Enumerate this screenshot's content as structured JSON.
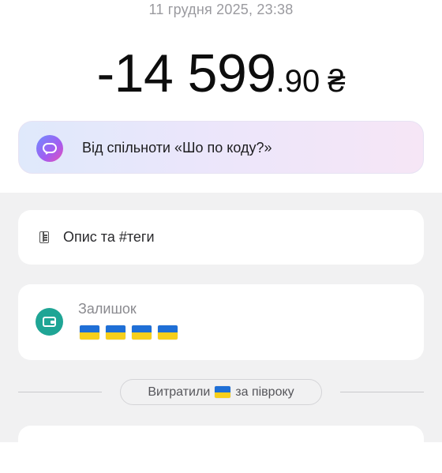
{
  "transaction": {
    "timestamp": "11 грудня 2025, 23:38",
    "amount_main": "-14 599",
    "amount_decimal": ".90",
    "currency_symbol": "₴"
  },
  "community": {
    "icon": "chat-bubble-icon",
    "label": "Від спільноти «Шо по коду?»"
  },
  "description": {
    "icon": "notebook-icon",
    "label": "Опис та #теги"
  },
  "balance": {
    "icon": "wallet-icon",
    "label": "Залишок",
    "value": "🇺🇦🇺🇦🇺🇦🇺🇦",
    "flag_count": 4
  },
  "spending": {
    "prefix": "Витратили",
    "flag": "🇺🇦",
    "suffix": "за півроку"
  },
  "colors": {
    "wallet_accent": "#1fa595",
    "flag_blue": "#1f6fd6",
    "flag_yellow": "#f7cf1b",
    "background_gray": "#f1f1f2"
  }
}
